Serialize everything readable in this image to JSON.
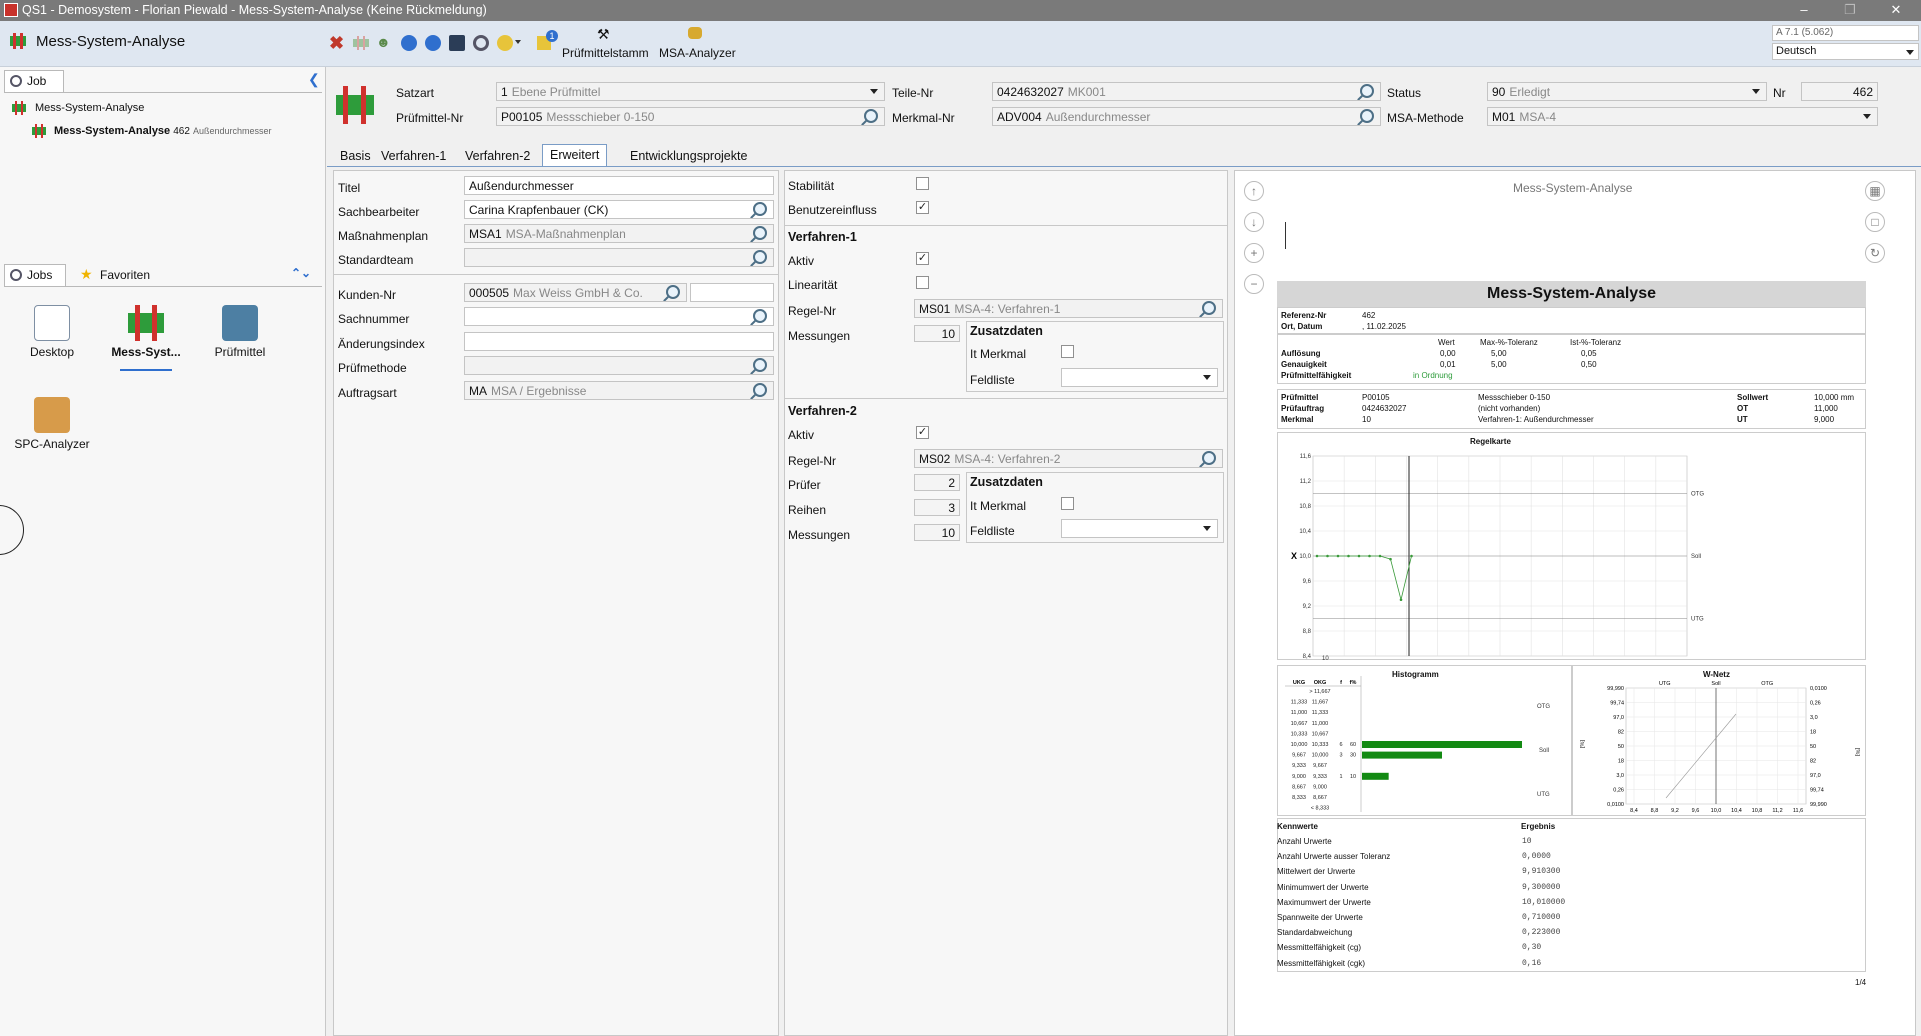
{
  "window": {
    "title": "QS1 - Demosystem - Florian Piewald - Mess-System-Analyse (Keine Rückmeldung)"
  },
  "toolbar": {
    "app_name": "Mess-System-Analyse",
    "pruefmittelstamm": "Prüfmittelstamm",
    "msa_analyzer": "MSA-Analyzer",
    "notify_count": "1",
    "version": "A 7.1 (5.062)",
    "language": "Deutsch"
  },
  "left": {
    "job_tab": "Job",
    "tree_root": "Mess-System-Analyse",
    "tree_child": "Mess-System-Analyse",
    "tree_child_nr": "462",
    "tree_child_desc": "Außendurchmesser",
    "jobs_tab": "Jobs",
    "fav_tab": "Favoriten",
    "tiles": {
      "desktop": "Desktop",
      "msa": "Mess-Syst...",
      "pruefmittel": "Prüfmittel",
      "spc": "SPC-Analyzer"
    }
  },
  "header": {
    "satzart_label": "Satzart",
    "satzart_val": "1",
    "satzart_desc": "Ebene Prüfmittel",
    "pm_label": "Prüfmittel-Nr",
    "pm_val": "P00105",
    "pm_desc": "Messschieber 0-150",
    "teile_label": "Teile-Nr",
    "teile_val": "0424632027",
    "teile_desc": "MK001",
    "merkmal_label": "Merkmal-Nr",
    "merkmal_val": "ADV004",
    "merkmal_desc": "Außendurchmesser",
    "status_label": "Status",
    "status_val": "90",
    "status_desc": "Erledigt",
    "methode_label": "MSA-Methode",
    "methode_val": "M01",
    "methode_desc": "MSA-4",
    "nr_label": "Nr",
    "nr_val": "462"
  },
  "tabs": [
    "Basis",
    "Verfahren-1",
    "Verfahren-2",
    "Erweitert",
    "Entwicklungsprojekte"
  ],
  "form": {
    "titel_label": "Titel",
    "titel_val": "Außendurchmesser",
    "sach_label": "Sachbearbeiter",
    "sach_val": "Carina Krapfenbauer (CK)",
    "mplan_label": "Maßnahmenplan",
    "mplan_val": "MSA1",
    "mplan_desc": "MSA-Maßnahmenplan",
    "team_label": "Standardteam",
    "kunde_label": "Kunden-Nr",
    "kunde_val": "000505",
    "kunde_desc": "Max Weiss GmbH & Co.",
    "sachnr_label": "Sachnummer",
    "aend_label": "Änderungsindex",
    "pmeth_label": "Prüfmethode",
    "auftr_label": "Auftragsart",
    "auftr_val": "MA",
    "auftr_desc": "MSA / Ergebnisse"
  },
  "mid": {
    "stab_label": "Stabilität",
    "benutzer_label": "Benutzereinfluss",
    "v1_title": "Verfahren-1",
    "v1_aktiv": "Aktiv",
    "v1_linear": "Linearität",
    "v1_regel_label": "Regel-Nr",
    "v1_regel_val": "MS01",
    "v1_regel_desc": "MSA-4: Verfahren-1",
    "v1_mess_label": "Messungen",
    "v1_mess_val": "10",
    "zus_title": "Zusatzdaten",
    "it_merkmal": "It Merkmal",
    "feldliste": "Feldliste",
    "v2_title": "Verfahren-2",
    "v2_aktiv": "Aktiv",
    "v2_regel_label": "Regel-Nr",
    "v2_regel_val": "MS02",
    "v2_regel_desc": "MSA-4: Verfahren-2",
    "v2_pruefer_label": "Prüfer",
    "v2_pruefer_val": "2",
    "v2_reihen_label": "Reihen",
    "v2_reihen_val": "3",
    "v2_mess_label": "Messungen",
    "v2_mess_val": "10"
  },
  "report": {
    "header": "Mess-System-Analyse",
    "title": "Mess-System-Analyse",
    "ref_label": "Referenz-Nr",
    "ref_val": "462",
    "ort_label": "Ort, Datum",
    "ort_val": ", 11.02.2025",
    "col_wert": "Wert",
    "col_max": "Max-%-Toleranz",
    "col_ist": "Ist-%-Toleranz",
    "aufl_label": "Auflösung",
    "aufl_w": "0,00",
    "aufl_max": "5,00",
    "aufl_ist": "0,05",
    "gen_label": "Genauigkeit",
    "gen_w": "0,01",
    "gen_max": "5,00",
    "gen_ist": "0,50",
    "pf_label": "Prüfmittelfähigkeit",
    "pf_val": "in Ordnung",
    "pm_label": "Prüfmittel",
    "pm_val": "P00105",
    "pm_desc": "Messschieber 0-150",
    "pa_label": "Prüfauftrag",
    "pa_val": "0424632027",
    "pa_desc": "(nicht vorhanden)",
    "mk_label": "Merkmal",
    "mk_val": "10",
    "mk_desc": "Verfahren-1: Außendurchmesser",
    "soll_label": "Sollwert",
    "soll_val": "10,000 mm",
    "ot_label": "OT",
    "ot_val": "11,000",
    "ut_label": "UT",
    "ut_val": "9,000",
    "regelkarte": "Regelkarte",
    "x_marker": "X",
    "otg": "OTG",
    "soll": "Soll",
    "utg": "UTG",
    "rk_x_first": "10",
    "rk_yticks": [
      "11,6",
      "11,2",
      "10,8",
      "10,4",
      "10,0",
      "9,6",
      "9,2",
      "8,8",
      "8,4"
    ],
    "histogramm": "Histogramm",
    "wnetz": "W-Netz",
    "hist_cols": [
      "UKG",
      "OKG",
      "f",
      "f%"
    ],
    "hist_rows": [
      [
        "",
        "> 11,667",
        "",
        ""
      ],
      [
        "11,333",
        "11,667",
        "",
        ""
      ],
      [
        "11,000",
        "11,333",
        "",
        ""
      ],
      [
        "10,667",
        "11,000",
        "",
        ""
      ],
      [
        "10,333",
        "10,667",
        "",
        ""
      ],
      [
        "10,000",
        "10,333",
        "6",
        "60"
      ],
      [
        "9,667",
        "10,000",
        "3",
        "30"
      ],
      [
        "9,333",
        "9,667",
        "",
        ""
      ],
      [
        "9,000",
        "9,333",
        "1",
        "10"
      ],
      [
        "8,667",
        "9,000",
        "",
        ""
      ],
      [
        "8,333",
        "8,667",
        "",
        ""
      ],
      [
        "",
        "< 8,333",
        "",
        ""
      ]
    ],
    "wn_left": [
      "99,990",
      "99,74",
      "97,0",
      "82",
      "50",
      "18",
      "3,0",
      "0,26",
      "0,0100"
    ],
    "wn_right": [
      "0,0100",
      "0,26",
      "3,0",
      "18",
      "50",
      "82",
      "97,0",
      "99,74",
      "99,990"
    ],
    "wn_x": [
      "8,4",
      "8,8",
      "9,2",
      "9,6",
      "10,0",
      "10,4",
      "10,8",
      "11,2",
      "11,6"
    ],
    "wn_pct": "[%]",
    "kennwerte": "Kennwerte",
    "ergebnis": "Ergebnis",
    "kw": [
      [
        "Anzahl Urwerte",
        "10"
      ],
      [
        "Anzahl Urwerte ausser Toleranz",
        "0,0000"
      ],
      [
        "Mittelwert der Urwerte",
        "9,910300"
      ],
      [
        "Minimumwert der Urwerte",
        "9,300000"
      ],
      [
        "Maximumwert der Urwerte",
        "10,010000"
      ],
      [
        "Spannweite der Urwerte",
        "0,710000"
      ],
      [
        "Standardabweichung",
        "0,223000"
      ],
      [
        "Messmittelfähigkeit (cg)",
        "0,30"
      ],
      [
        "Messmittelfähigkeit (cgk)",
        "0,16"
      ]
    ],
    "page": "1/4"
  },
  "chart_data": [
    {
      "type": "line",
      "title": "Regelkarte",
      "x": [
        1,
        2,
        3,
        4,
        5,
        6,
        7,
        8,
        9,
        10
      ],
      "values": [
        10.0,
        10.0,
        10.0,
        10.0,
        10.0,
        10.0,
        10.0,
        9.95,
        9.3,
        10.0
      ],
      "ylim": [
        8.4,
        11.6
      ],
      "reference_lines": {
        "OTG": 11.0,
        "Soll": 10.0,
        "UTG": 9.0
      }
    },
    {
      "type": "bar",
      "title": "Histogramm",
      "categories": [
        "> 11,667",
        "11,333-11,667",
        "11,000-11,333",
        "10,667-11,000",
        "10,333-10,667",
        "10,000-10,333",
        "9,667-10,000",
        "9,333-9,667",
        "9,000-9,333",
        "8,667-9,000",
        "8,333-8,667",
        "< 8,333"
      ],
      "values": [
        0,
        0,
        0,
        0,
        0,
        60,
        30,
        0,
        10,
        0,
        0,
        0
      ],
      "orientation": "horizontal"
    }
  ]
}
